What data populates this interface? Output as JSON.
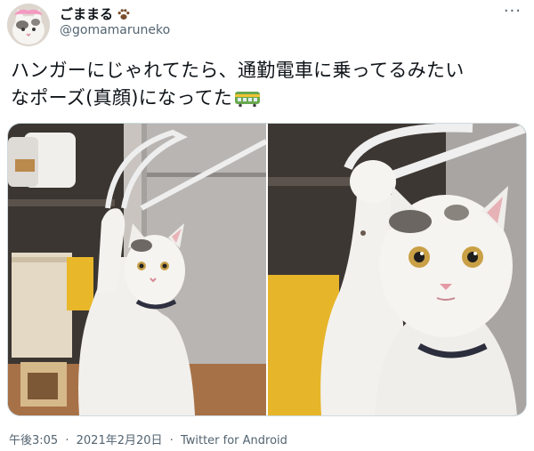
{
  "user": {
    "display_name": "ごままる",
    "handle": "@gomamaruneko",
    "avatar_icon": "cat-avatar-icon",
    "badge_icon": "paw-print-icon"
  },
  "menu": {
    "more_icon": "more-options-icon",
    "label": "···"
  },
  "tweet": {
    "text_line1": "ハンガーにじゃれてたら、通勤電車に乗ってるみたい",
    "text_line2": "なポーズ(真顔)になってた",
    "emoji_icon": "train-icon"
  },
  "media": {
    "photos": [
      {
        "name": "photo-cat-full",
        "icon": "cat-photo-icon"
      },
      {
        "name": "photo-cat-closeup",
        "icon": "cat-photo-icon"
      }
    ]
  },
  "meta": {
    "time": "午後3:05",
    "separator": "·",
    "date": "2021年2月20日",
    "source": "Twitter for Android"
  },
  "colors": {
    "text_primary": "#0f1419",
    "text_secondary": "#536471",
    "border": "#cfd9de"
  }
}
